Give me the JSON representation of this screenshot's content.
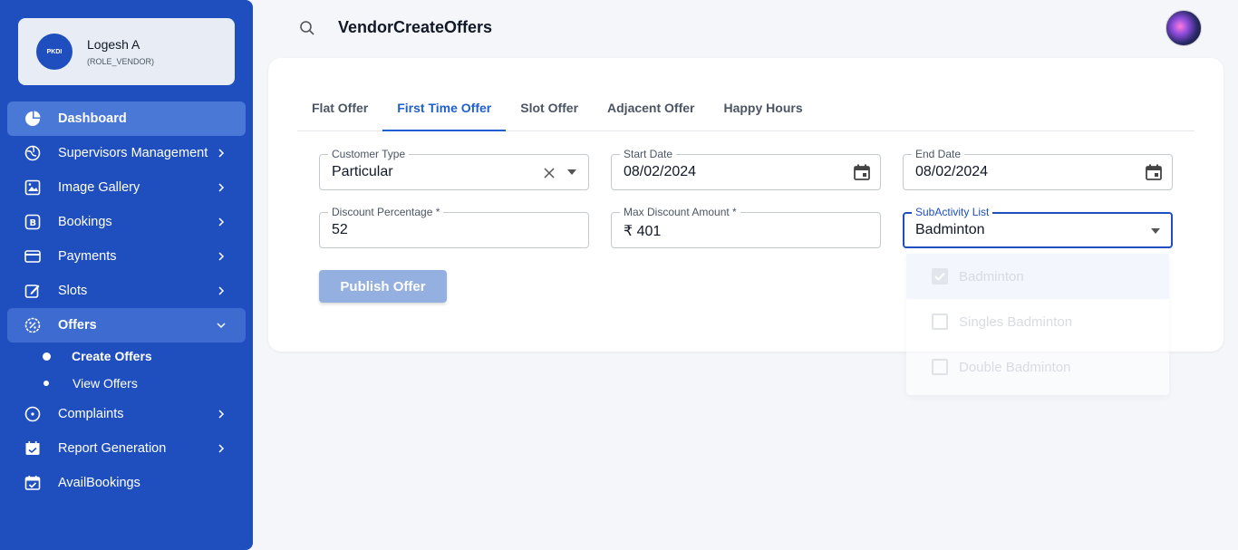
{
  "profile": {
    "name": "Logesh A",
    "role": "(ROLE_VENDOR)",
    "logo_text": "PKDI"
  },
  "sidebar": {
    "items": [
      {
        "label": "Dashboard"
      },
      {
        "label": "Supervisors Management"
      },
      {
        "label": "Image Gallery"
      },
      {
        "label": "Bookings"
      },
      {
        "label": "Payments"
      },
      {
        "label": "Slots"
      },
      {
        "label": "Offers"
      },
      {
        "label": "Complaints"
      },
      {
        "label": "Report Generation"
      },
      {
        "label": "AvailBookings"
      }
    ],
    "offers_sub": [
      {
        "label": "Create Offers"
      },
      {
        "label": "View Offers"
      }
    ]
  },
  "topbar": {
    "title": "VendorCreateOffers"
  },
  "tabs": [
    {
      "label": "Flat Offer"
    },
    {
      "label": "First Time Offer"
    },
    {
      "label": "Slot Offer"
    },
    {
      "label": "Adjacent Offer"
    },
    {
      "label": "Happy Hours"
    }
  ],
  "form": {
    "customer_type": {
      "label": "Customer Type",
      "value": "Particular"
    },
    "start_date": {
      "label": "Start Date",
      "value": "08/02/2024"
    },
    "end_date": {
      "label": "End Date",
      "value": "08/02/2024"
    },
    "discount_percentage": {
      "label": "Discount Percentage *",
      "value": "52"
    },
    "max_discount": {
      "label": "Max Discount Amount *",
      "value": "₹ 401"
    },
    "subactivity": {
      "label": "SubActivity List",
      "value": "Badminton"
    },
    "publish_label": "Publish Offer"
  },
  "dropdown": {
    "options": [
      {
        "label": "Badminton",
        "checked": true
      },
      {
        "label": "Singles Badminton",
        "checked": false
      },
      {
        "label": "Double Badminton",
        "checked": false
      }
    ]
  },
  "colors": {
    "sidebar_bg": "#1f4fbf",
    "accent": "#1f5fcf",
    "publish_disabled": "#94b0e0"
  }
}
